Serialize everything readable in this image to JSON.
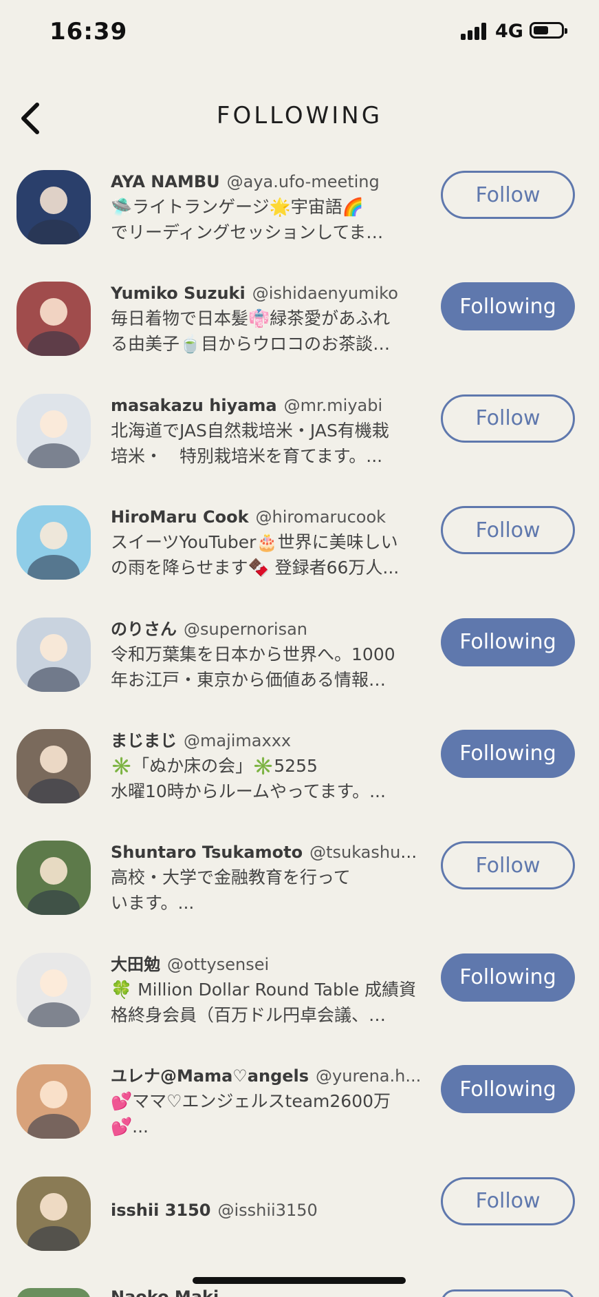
{
  "status": {
    "time": "16:39",
    "network": "4G",
    "battery_level": 0.55
  },
  "header": {
    "title": "FOLLOWING"
  },
  "users": [
    {
      "name": "AYA NAMBU",
      "handle": "@aya.ufo-meeting",
      "bio": [
        "🛸ライトランゲージ🌟宇宙語🌈",
        "でリーディングセッションしてま…"
      ],
      "button": "Follow",
      "state": "follow",
      "avatar_color": "#2a3f6b"
    },
    {
      "name": "Yumiko Suzuki",
      "handle": "@ishidaenyumiko",
      "bio": [
        "毎日着物で日本髪👘緑茶愛があふれ",
        "る由美子🍵目からウロコのお茶談…"
      ],
      "button": "Following",
      "state": "following",
      "avatar_color": "#a04c4c"
    },
    {
      "name": "masakazu hiyama",
      "handle": "@mr.miyabi",
      "bio": [
        "北海道でJAS自然栽培米・JAS有機栽",
        "培米・　特別栽培米を育てます。..."
      ],
      "button": "Follow",
      "state": "follow",
      "avatar_color": "#dfe4ea"
    },
    {
      "name": "HiroMaru Cook",
      "handle": "@hiromarucook",
      "bio": [
        "スイーツYouTuber🎂世界に美味しい",
        "の雨を降らせます🍫 登録者66万人..."
      ],
      "button": "Follow",
      "state": "follow",
      "avatar_color": "#8fcde8"
    },
    {
      "name": "のりさん",
      "handle": "@supernorisan",
      "bio": [
        "令和万葉集を日本から世界へ。1000",
        "年お江戸・東京から価値ある情報…"
      ],
      "button": "Following",
      "state": "following",
      "avatar_color": "#c9d3df"
    },
    {
      "name": "まじまじ",
      "handle": "@majimaxxx",
      "bio": [
        "✳️「ぬか床の会」✳️5255",
        "水曜10時からルームやってます。..."
      ],
      "button": "Following",
      "state": "following",
      "avatar_color": "#7a6a5c"
    },
    {
      "name": "Shuntaro Tsukamoto",
      "handle": "@tsukashun1...",
      "bio": [
        "高校・大学で金融教育を行って",
        "います。..."
      ],
      "button": "Follow",
      "state": "follow",
      "avatar_color": "#5d7a4a"
    },
    {
      "name": "大田勉",
      "handle": "@ottysensei",
      "bio": [
        "🍀 Million Dollar Round Table 成績資",
        "格終身会員（百万ドル円卓会議、…"
      ],
      "button": "Following",
      "state": "following",
      "avatar_color": "#e8e8e8"
    },
    {
      "name": "ユレナ@Mama♡angels",
      "handle": "@yurena.h...",
      "bio": [
        "💕ママ♡エンジェルスteam2600万",
        "💕..."
      ],
      "button": "Following",
      "state": "following",
      "avatar_color": "#d8a27a"
    },
    {
      "name": "isshii 3150",
      "handle": "@isshii3150",
      "bio": [],
      "button": "Follow",
      "state": "follow",
      "avatar_color": "#8a7b55"
    }
  ],
  "partial_row": {
    "name": "Naoko Maki…"
  }
}
